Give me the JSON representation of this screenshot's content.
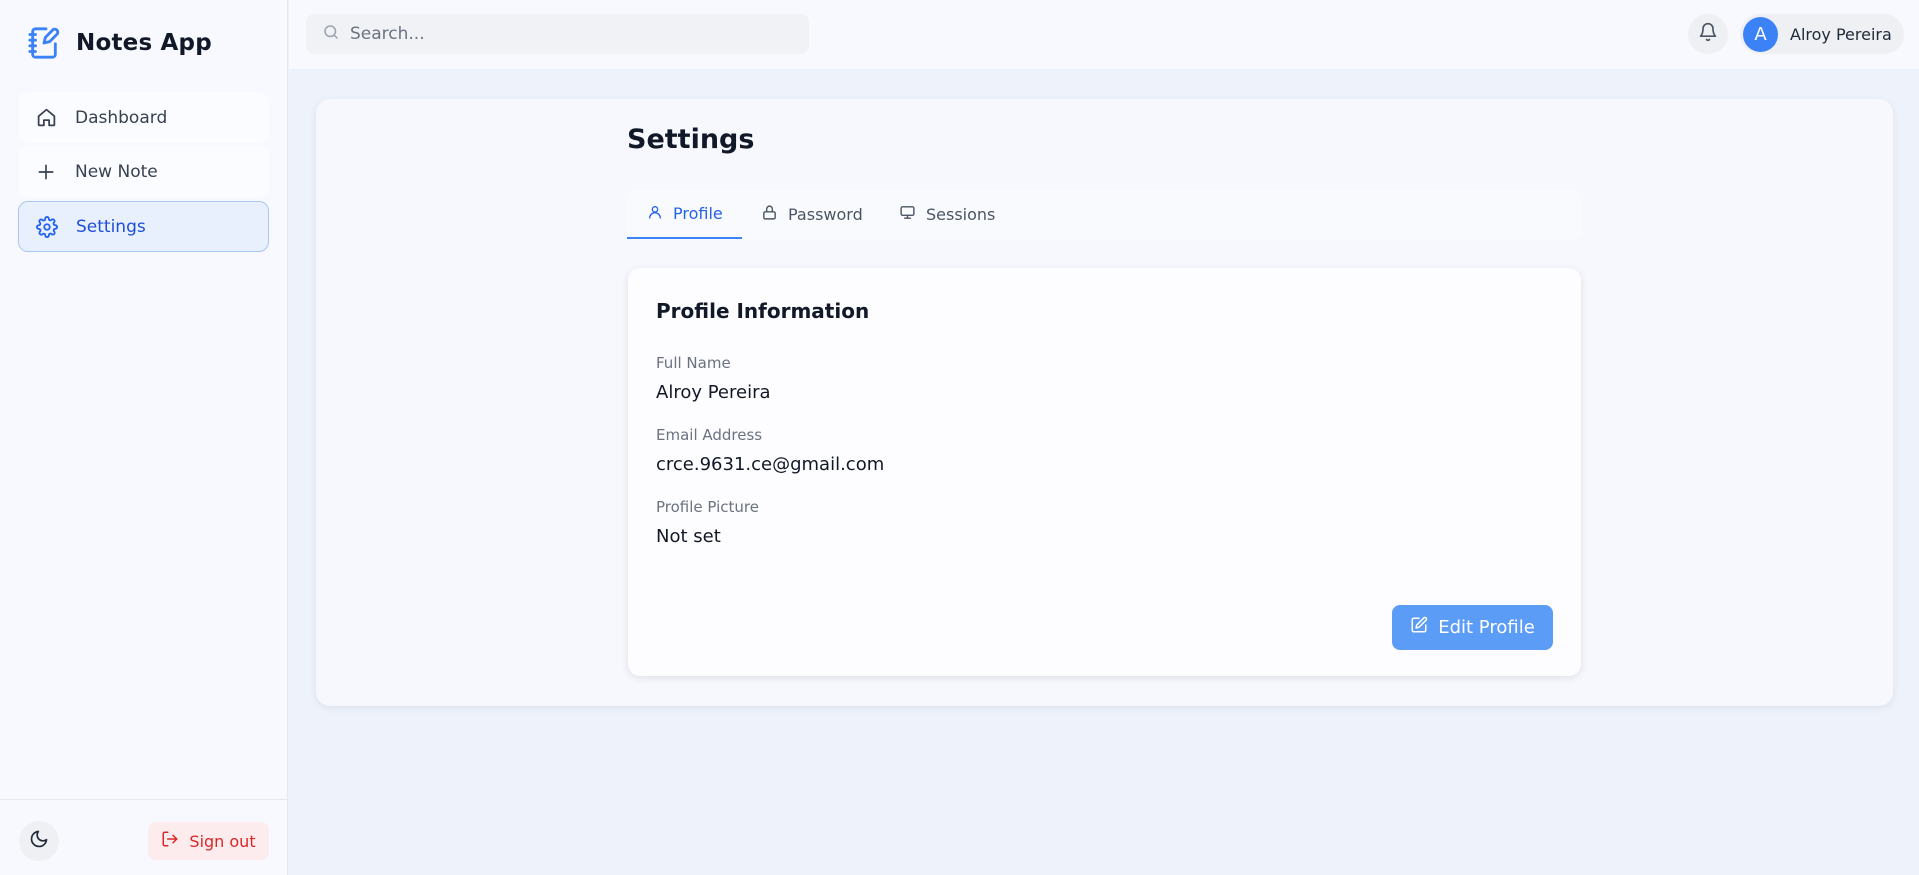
{
  "app": {
    "title": "Notes App"
  },
  "sidebar": {
    "items": [
      {
        "label": "Dashboard",
        "icon": "home-icon",
        "active": false
      },
      {
        "label": "New Note",
        "icon": "plus-icon",
        "active": false
      },
      {
        "label": "Settings",
        "icon": "gear-icon",
        "active": true
      }
    ],
    "theme_toggle_icon": "moon-icon",
    "signout_label": "Sign out"
  },
  "header": {
    "search": {
      "placeholder": "Search...",
      "value": ""
    },
    "notification_icon": "bell-icon",
    "user": {
      "initial": "A",
      "name": "Alroy Pereira"
    }
  },
  "settings": {
    "title": "Settings",
    "tabs": [
      {
        "label": "Profile",
        "icon": "user-icon",
        "active": true
      },
      {
        "label": "Password",
        "icon": "lock-icon",
        "active": false
      },
      {
        "label": "Sessions",
        "icon": "monitor-icon",
        "active": false
      }
    ],
    "profile": {
      "card_title": "Profile Information",
      "fields": [
        {
          "label": "Full Name",
          "value": "Alroy Pereira"
        },
        {
          "label": "Email Address",
          "value": "crce.9631.ce@gmail.com"
        },
        {
          "label": "Profile Picture",
          "value": "Not set"
        }
      ],
      "edit_button_label": "Edit Profile"
    }
  },
  "colors": {
    "accent": "#3b82f6",
    "active_nav_bg": "#e8f0fe",
    "danger": "#dc2626",
    "edit_button": "#5b9cf6"
  }
}
